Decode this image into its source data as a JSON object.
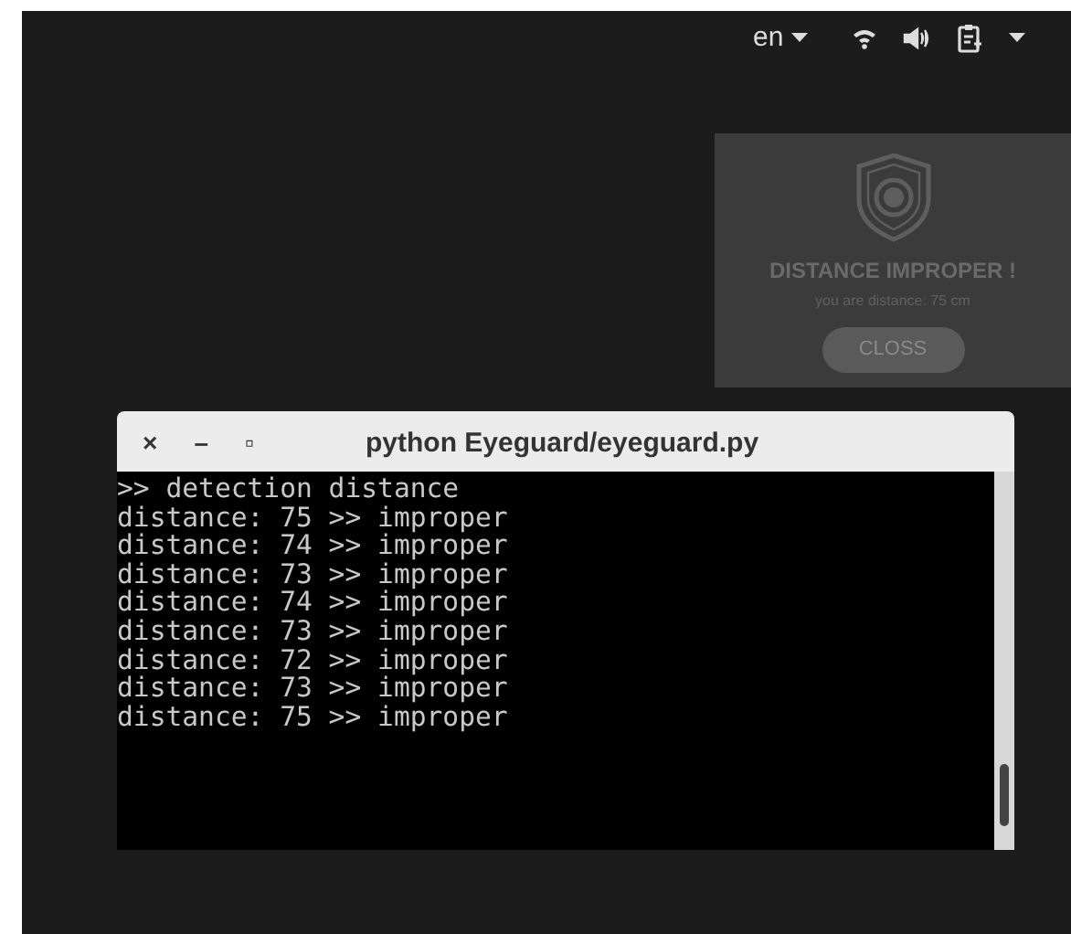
{
  "top_bar": {
    "language": "en"
  },
  "notification": {
    "title": "DISTANCE IMPROPER !",
    "message": "you are distance: 75 cm",
    "button": "CLOSS"
  },
  "terminal": {
    "controls": [
      "×",
      "–",
      "▫"
    ],
    "title": "python Eyeguard/eyeguard.py",
    "lines": [
      ">> detection distance",
      "distance: 75 >> improper",
      "distance: 74 >> improper",
      "distance: 73 >> improper",
      "distance: 74 >> improper",
      "distance: 73 >> improper",
      "distance: 72 >> improper",
      "distance: 73 >> improper",
      "distance: 75 >> improper"
    ]
  }
}
